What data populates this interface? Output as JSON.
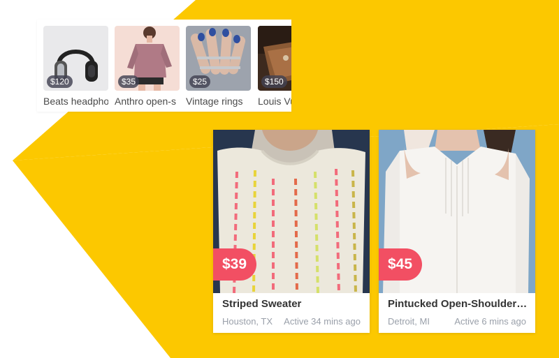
{
  "colors": {
    "accent_yellow": "#fcc800",
    "price_red": "#f24f63",
    "muted_text": "#9aa0aa"
  },
  "recent_listings": [
    {
      "price": "$120",
      "name": "Beats headpho"
    },
    {
      "price": "$35",
      "name": "Anthro open-s"
    },
    {
      "price": "$25",
      "name": "Vintage rings"
    },
    {
      "price": "$150",
      "name": "Louis Vu"
    }
  ],
  "cards": [
    {
      "price": "$39",
      "title": "Striped Sweater",
      "location": "Houston, TX",
      "active": "Active 34 mins ago"
    },
    {
      "price": "$45",
      "title": "Pintucked Open-Shoulder ...",
      "location": "Detroit, MI",
      "active": "Active 6 mins ago"
    }
  ]
}
